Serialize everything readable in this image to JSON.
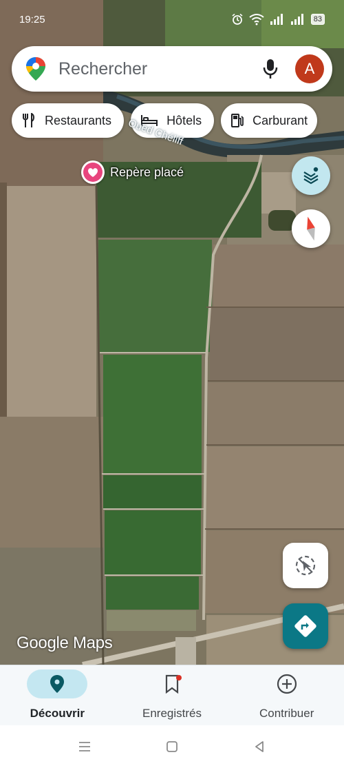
{
  "status_bar": {
    "time": "19:25",
    "battery": "83",
    "icons": [
      "alarm-icon",
      "wifi-icon",
      "signal-icon",
      "signal-icon"
    ]
  },
  "search": {
    "placeholder": "Rechercher",
    "logo_icon": "maps-pin-logo-icon",
    "mic_icon": "microphone-icon",
    "avatar_letter": "A",
    "avatar_color": "#c0391b"
  },
  "chips": [
    {
      "label": "Restaurants",
      "icon": "fork-knife-icon"
    },
    {
      "label": "Hôtels",
      "icon": "bed-icon"
    },
    {
      "label": "Carburant",
      "icon": "fuel-pump-icon"
    }
  ],
  "map": {
    "marker_label": "Repère placé",
    "marker_icon": "heart-icon",
    "river_label": "Oued Chéliff",
    "attribution": "Google Maps"
  },
  "buttons": {
    "layers_icon": "layers-icon",
    "compass_icon": "compass-icon",
    "location_icon": "my-location-icon",
    "directions_icon": "directions-icon",
    "directions_color": "#0b7886"
  },
  "bottom_nav": [
    {
      "label": "Découvrir",
      "icon": "location-pin-icon",
      "active": true
    },
    {
      "label": "Enregistrés",
      "icon": "bookmark-icon",
      "active": false
    },
    {
      "label": "Contribuer",
      "icon": "add-circle-icon",
      "active": false
    }
  ],
  "system_nav": [
    "menu-icon",
    "home-icon",
    "back-icon"
  ]
}
